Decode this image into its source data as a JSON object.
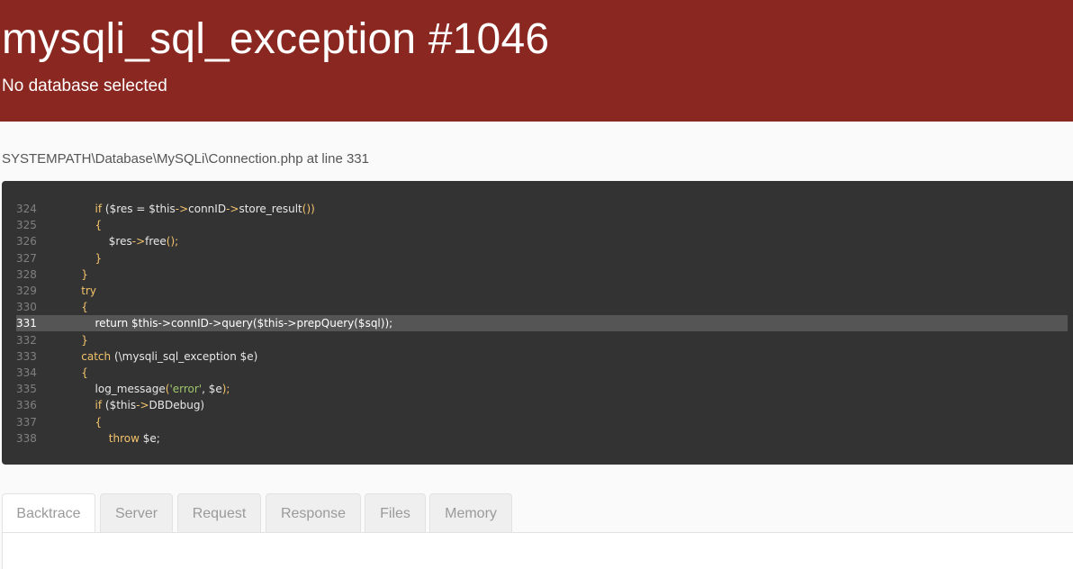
{
  "header": {
    "title": "mysqli_sql_exception #1046",
    "message": "No database selected"
  },
  "location": "SYSTEMPATH\\Database\\MySQLi\\Connection.php at line 331",
  "code": {
    "highlight_line": "331",
    "lines": [
      {
        "num": "324",
        "indent": "        ",
        "parts": [
          {
            "t": "if",
            "c": "kw"
          },
          {
            "t": " ($res = $this"
          },
          {
            "t": "->",
            "c": "pn"
          },
          {
            "t": "connID"
          },
          {
            "t": "->",
            "c": "pn"
          },
          {
            "t": "store_result"
          },
          {
            "t": "())",
            "c": "pn"
          }
        ]
      },
      {
        "num": "325",
        "indent": "        ",
        "parts": [
          {
            "t": "{",
            "c": "pn"
          }
        ]
      },
      {
        "num": "326",
        "indent": "            ",
        "parts": [
          {
            "t": "$res"
          },
          {
            "t": "->",
            "c": "pn"
          },
          {
            "t": "free"
          },
          {
            "t": "();",
            "c": "pn"
          }
        ]
      },
      {
        "num": "327",
        "indent": "        ",
        "parts": [
          {
            "t": "}",
            "c": "pn"
          }
        ]
      },
      {
        "num": "328",
        "indent": "    ",
        "parts": [
          {
            "t": "}",
            "c": "pn"
          }
        ]
      },
      {
        "num": "329",
        "indent": "    ",
        "parts": [
          {
            "t": "try",
            "c": "kw"
          }
        ]
      },
      {
        "num": "330",
        "indent": "    ",
        "parts": [
          {
            "t": "{",
            "c": "pn"
          }
        ]
      },
      {
        "num": "331",
        "indent": "        ",
        "parts": [
          {
            "t": "return $this->connID->query($this->prepQuery($sql));"
          }
        ]
      },
      {
        "num": "332",
        "indent": "    ",
        "parts": [
          {
            "t": "}",
            "c": "pn"
          }
        ]
      },
      {
        "num": "333",
        "indent": "    ",
        "parts": [
          {
            "t": "catch",
            "c": "kw"
          },
          {
            "t": " (\\mysqli_sql_exception $e)"
          }
        ]
      },
      {
        "num": "334",
        "indent": "    ",
        "parts": [
          {
            "t": "{",
            "c": "pn"
          }
        ]
      },
      {
        "num": "335",
        "indent": "        ",
        "parts": [
          {
            "t": "log_message"
          },
          {
            "t": "(",
            "c": "pn"
          },
          {
            "t": "'error'",
            "c": "str"
          },
          {
            "t": ", $e"
          },
          {
            "t": ");",
            "c": "pn"
          }
        ]
      },
      {
        "num": "336",
        "indent": "        ",
        "parts": [
          {
            "t": "if",
            "c": "kw"
          },
          {
            "t": " ($this"
          },
          {
            "t": "->",
            "c": "pn"
          },
          {
            "t": "DBDebug)"
          }
        ]
      },
      {
        "num": "337",
        "indent": "        ",
        "parts": [
          {
            "t": "{",
            "c": "pn"
          }
        ]
      },
      {
        "num": "338",
        "indent": "            ",
        "parts": [
          {
            "t": "throw",
            "c": "kw"
          },
          {
            "t": " $e;"
          }
        ]
      }
    ]
  },
  "tabs": [
    {
      "label": "Backtrace",
      "active": true
    },
    {
      "label": "Server",
      "active": false
    },
    {
      "label": "Request",
      "active": false
    },
    {
      "label": "Response",
      "active": false
    },
    {
      "label": "Files",
      "active": false
    },
    {
      "label": "Memory",
      "active": false
    }
  ],
  "colors": {
    "header_bg": "#8a2720",
    "code_bg": "#333333",
    "keyword": "#f4c36b",
    "string": "#9fc66b"
  }
}
